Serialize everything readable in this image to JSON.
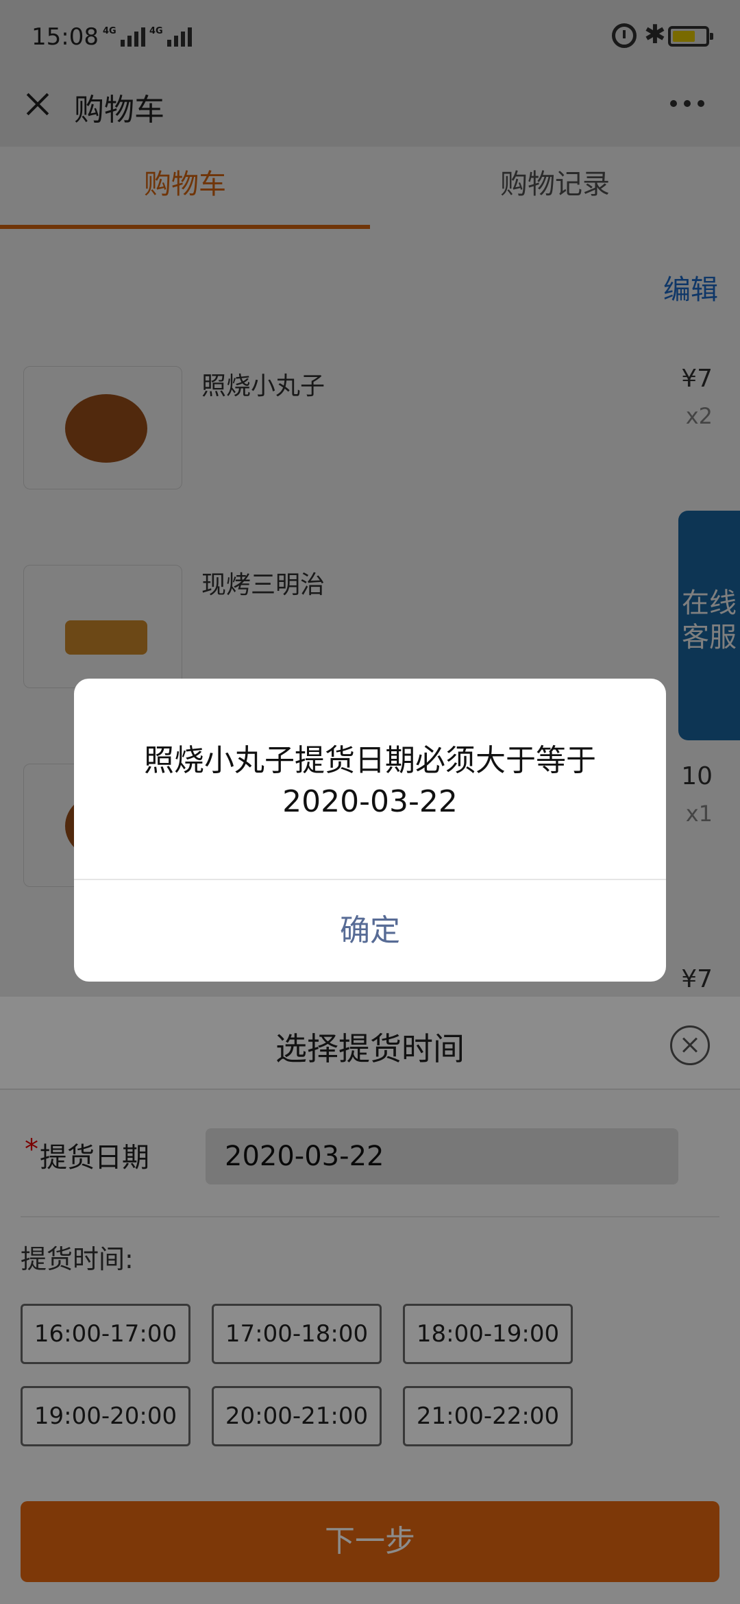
{
  "status_bar": {
    "time": "15:08",
    "network1": "4G",
    "network2": "4G",
    "bluetooth_glyph": "✱",
    "battery_color": "#f2d400"
  },
  "nav": {
    "title": "购物车",
    "close_icon": "close-icon",
    "more_icon": "more-icon"
  },
  "tabs": [
    {
      "label": "购物车",
      "active": true
    },
    {
      "label": "购物记录",
      "active": false
    }
  ],
  "edit_label": "编辑",
  "cart_items": [
    {
      "name": "照烧小丸子",
      "price": "¥7",
      "qty": "x2"
    },
    {
      "name": "现烤三明治",
      "price": "¥",
      "qty": ""
    },
    {
      "name": "",
      "price": "10",
      "qty": "x1"
    },
    {
      "name": "",
      "price": "¥7",
      "qty": ""
    }
  ],
  "customer_service": "在线客服",
  "sheet": {
    "title": "选择提货时间",
    "required_mark": "*",
    "date_label": "提货日期",
    "date_value": "2020-03-22",
    "time_label": "提货时间:",
    "time_slots": [
      "16:00-17:00",
      "17:00-18:00",
      "18:00-19:00",
      "19:00-20:00",
      "20:00-21:00",
      "21:00-22:00"
    ],
    "next_button": "下一步",
    "accent_color": "#e4670f"
  },
  "modal": {
    "message": "照烧小丸子提货日期必须大于等于2020-03-22",
    "confirm": "确定",
    "confirm_color": "#576b95"
  }
}
